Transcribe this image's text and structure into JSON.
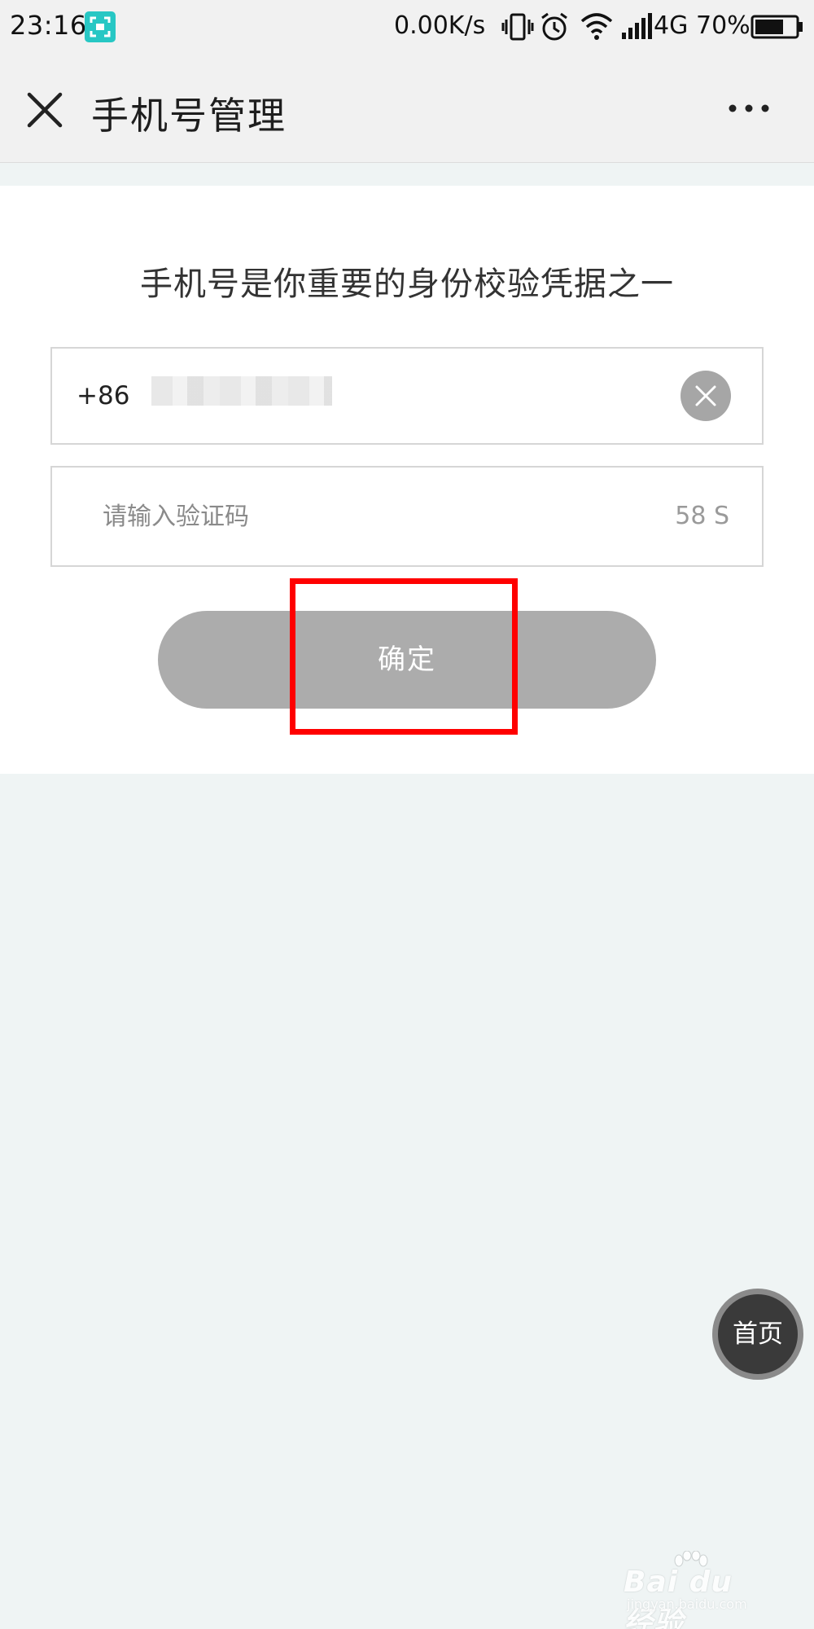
{
  "status_bar": {
    "time": "23:16",
    "speed": "0.00K/s",
    "network": "4G",
    "battery": "70%",
    "icons": [
      "screenshot-icon",
      "vibrate-icon",
      "alarm-icon",
      "wifi-icon",
      "signal-icon",
      "battery-icon"
    ]
  },
  "nav": {
    "title": "手机号管理",
    "close_icon": "close-icon",
    "more_icon": "more-icon"
  },
  "form": {
    "headline": "手机号是你重要的身份校验凭据之一",
    "country_code": "+86",
    "code_placeholder": "请输入验证码",
    "countdown": "58 S",
    "confirm_label": "确定"
  },
  "floating": {
    "home_label": "首页"
  },
  "watermark": {
    "main": "Bai du 经验",
    "sub": "jingyan.baidu.com"
  },
  "colors": {
    "highlight": "#ff0000",
    "button_disabled": "#acacac",
    "status_accent": "#27c7c4"
  }
}
